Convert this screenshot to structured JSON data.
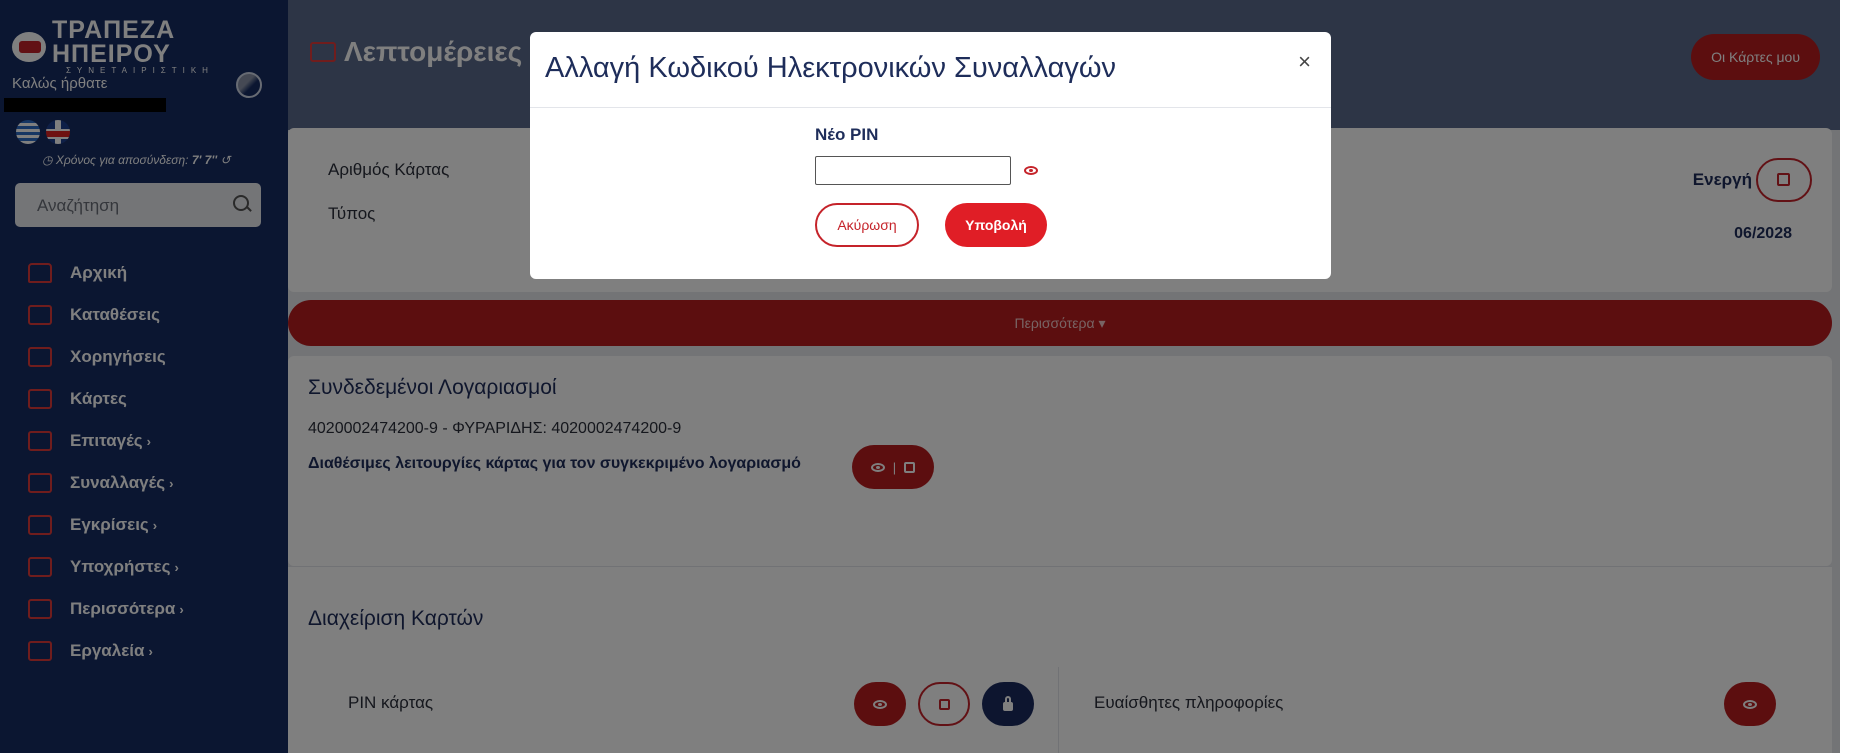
{
  "brand": {
    "title": "ΤΡΑΠΕΖΑ ΗΠΕΙΡΟΥ",
    "subtitle": "ΣΥΝΕΤΑΙΡΙΣΤΙΚΗ"
  },
  "sidebar": {
    "welcome": "Καλώς ήρθατε",
    "timeout_label": "Χρόνος για αποσύνδεση:",
    "timeout_value": "7' 7''",
    "search_placeholder": "Αναζήτηση",
    "items": [
      {
        "label": "Αρχική",
        "icon": "home-icon"
      },
      {
        "label": "Καταθέσεις",
        "icon": "wallet-icon"
      },
      {
        "label": "Χορηγήσεις",
        "icon": "loan-icon"
      },
      {
        "label": "Κάρτες",
        "icon": "card-icon"
      },
      {
        "label": "Επιταγές",
        "icon": "cheque-icon",
        "chevron": "›"
      },
      {
        "label": "Συναλλαγές",
        "icon": "transactions-icon",
        "chevron": "›"
      },
      {
        "label": "Εγκρίσεις",
        "icon": "approvals-icon",
        "chevron": "›"
      },
      {
        "label": "Υποχρήστες",
        "icon": "subusers-icon",
        "chevron": "›"
      },
      {
        "label": "Περισσότερα",
        "icon": "sliders-icon",
        "chevron": "›"
      },
      {
        "label": "Εργαλεία",
        "icon": "tools-icon",
        "chevron": "›"
      }
    ]
  },
  "header": {
    "title": "Λεπτομέρειες",
    "my_cards": "Οι Κάρτες μου"
  },
  "card": {
    "number_label": "Αριθμός Κάρτας",
    "type_label": "Τύπος",
    "status": "Ενεργή",
    "expiry": "06/2028"
  },
  "more_label": "Περισσότερα ▾",
  "linked": {
    "title": "Συνδεδεμένοι Λογαριασμοί",
    "account": "4020002474200-9 - ΦΥΡΑΡΙΔΗΣ: 4020002474200-9",
    "functions": "Διαθέσιμες λειτουργίες κάρτας για τον συγκεκριμένο λογαριασμό",
    "separator": "|"
  },
  "management": {
    "title": "Διαχείριση Καρτών",
    "pin_label": "PIN κάρτας",
    "sensitive_label": "Ευαίσθητες πληροφορίες"
  },
  "modal": {
    "title": "Αλλαγή Κωδικού Ηλεκτρονικών Συναλλαγών",
    "close": "×",
    "field_label": "Νέο PIN",
    "field_value": "",
    "cancel": "Ακύρωση",
    "submit": "Υποβολή"
  },
  "colors": {
    "navy": "#162c63",
    "red": "#b81c1f",
    "accent_red": "#e01e26"
  }
}
